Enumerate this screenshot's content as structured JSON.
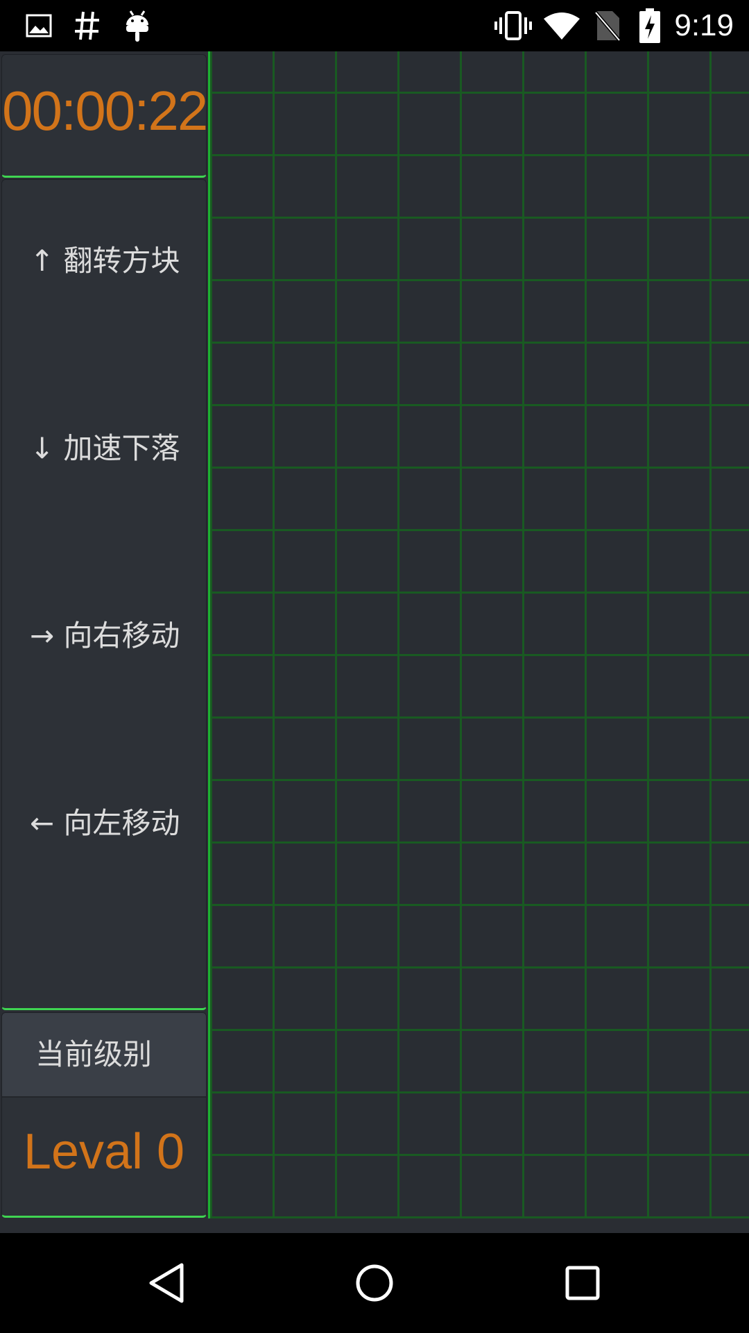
{
  "status_bar": {
    "time": "9:19",
    "left_icons": [
      "image-icon",
      "hash-icon",
      "android-icon"
    ],
    "right_icons": [
      "vibrate-icon",
      "wifi-icon",
      "no-sim-icon",
      "battery-charging-icon"
    ]
  },
  "game": {
    "timer": "00:00:22",
    "controls": [
      {
        "label": "↑ 翻转方块"
      },
      {
        "label": "↓ 加速下落"
      },
      {
        "label": "→ 向右移动"
      },
      {
        "label": "← 向左移动"
      }
    ],
    "level_label": "当前级别",
    "level_value": "Leval 0"
  },
  "colors": {
    "accent_orange": "#d2741a",
    "grid_green": "#195a22",
    "divider_green": "#3fd552",
    "background": "#2a2d33"
  },
  "nav_bar": {
    "buttons": [
      "back-icon",
      "home-icon",
      "recents-icon"
    ]
  }
}
